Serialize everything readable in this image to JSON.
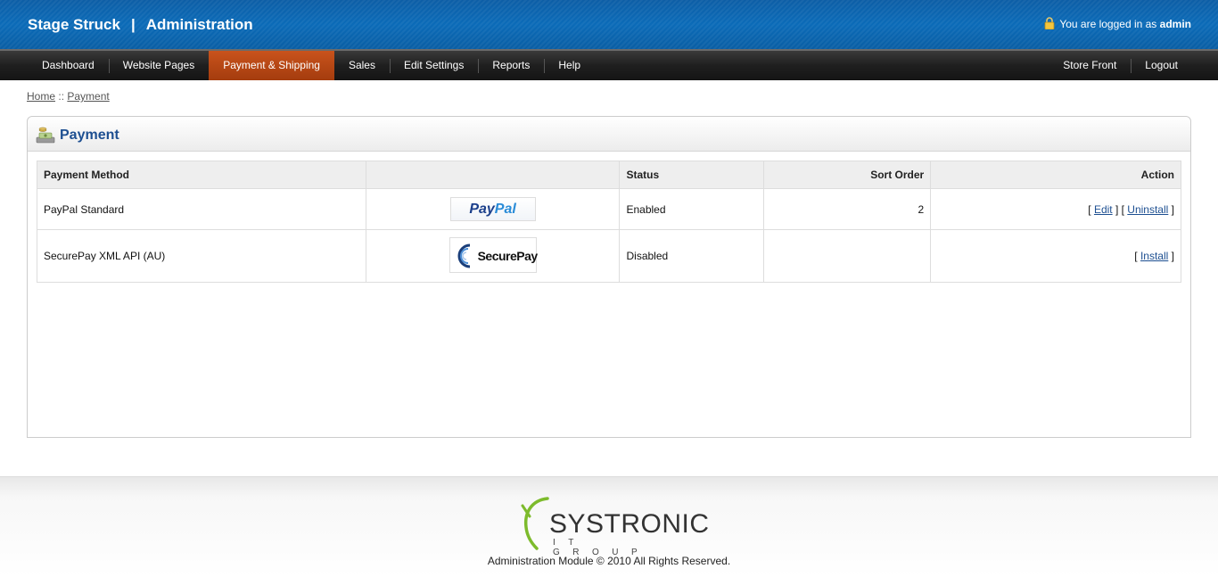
{
  "header": {
    "site_name": "Stage Struck",
    "separator": "|",
    "section": "Administration",
    "login_prefix": "You are logged in as",
    "username": "admin"
  },
  "nav": {
    "left": [
      {
        "label": "Dashboard"
      },
      {
        "label": "Website Pages"
      },
      {
        "label": "Payment & Shipping",
        "active": true
      },
      {
        "label": "Sales"
      },
      {
        "label": "Edit Settings"
      },
      {
        "label": "Reports"
      },
      {
        "label": "Help"
      }
    ],
    "right": [
      {
        "label": "Store Front"
      },
      {
        "label": "Logout"
      }
    ]
  },
  "breadcrumb": {
    "home": "Home",
    "sep": "::",
    "current": "Payment"
  },
  "panel": {
    "title": "Payment",
    "columns": [
      "Payment Method",
      "",
      "Status",
      "Sort Order",
      "Action"
    ],
    "rows": [
      {
        "method": "PayPal Standard",
        "logo": "PayPal",
        "status": "Enabled",
        "sort_order": "2",
        "actions": [
          "Edit",
          "Uninstall"
        ]
      },
      {
        "method": "SecurePay XML API (AU)",
        "logo": "SecurePay",
        "status": "Disabled",
        "sort_order": "",
        "actions": [
          "Install"
        ]
      }
    ]
  },
  "footer": {
    "logo_text": "SYSTRONIC",
    "logo_sub": "IT GROUP",
    "copyright": "Administration Module © 2010 All Rights Reserved."
  },
  "colors": {
    "header_blue": "#0b6bb8",
    "nav_active": "#b9471a",
    "title_blue": "#1d4f91",
    "logo_green": "#7dbb2c"
  }
}
